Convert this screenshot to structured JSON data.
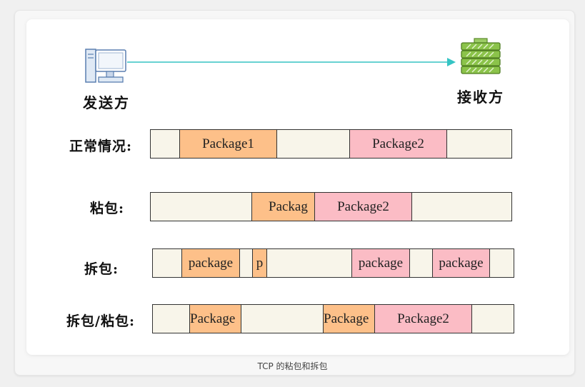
{
  "sender": {
    "label": "发送方",
    "icon": "computer-icon"
  },
  "receiver": {
    "label": "接收方",
    "icon": "server-icon"
  },
  "rows": [
    {
      "label": "正常情况:",
      "segments": [
        "Package1",
        "Package2"
      ]
    },
    {
      "label": "粘包:",
      "segments": [
        "Packag",
        "Package2"
      ]
    },
    {
      "label": "拆包:",
      "segments": [
        "package",
        "p",
        "package",
        "package"
      ]
    },
    {
      "label": "拆包/粘包:",
      "segments": [
        "Package",
        "Package",
        "Package2"
      ]
    }
  ],
  "caption": "TCP 的粘包和拆包",
  "colors": {
    "orange": "#fdc089",
    "pink": "#fbbcc5",
    "bar": "#f8f5ea",
    "arrow": "#35c4c4"
  }
}
